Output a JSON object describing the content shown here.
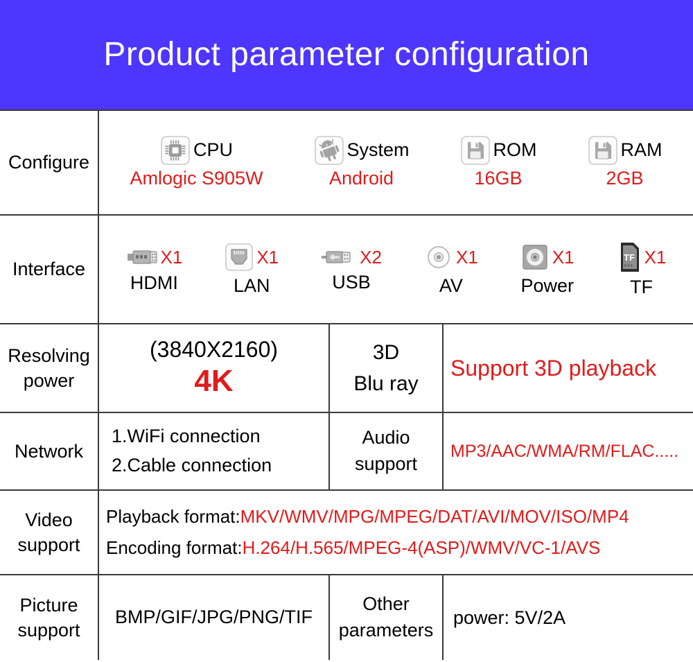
{
  "header": {
    "title": "Product parameter configuration",
    "background_color": "#4d36fe",
    "text_color": "#ffffff"
  },
  "colors": {
    "accent_red": "#e01b1b",
    "banner_blue": "#4d36fe",
    "border": "#3a3a3a"
  },
  "rows": {
    "configure": {
      "label": "Configure",
      "items": [
        {
          "icon": "cpu-chip-icon",
          "name": "CPU",
          "value": "Amlogic S905W"
        },
        {
          "icon": "android-robot-icon",
          "name": "System",
          "value": "Android"
        },
        {
          "icon": "floppy-disk-icon",
          "name": "ROM",
          "value": "16GB"
        },
        {
          "icon": "floppy-disk-icon",
          "name": "RAM",
          "value": "2GB"
        }
      ]
    },
    "interface": {
      "label": "Interface",
      "items": [
        {
          "icon": "hdmi-connector-icon",
          "count": "X1",
          "label": "HDMI"
        },
        {
          "icon": "lan-rj45-port-icon",
          "count": "X1",
          "label": "LAN"
        },
        {
          "icon": "usb-connector-icon",
          "count": "X2",
          "label": "USB"
        },
        {
          "icon": "av-jack-icon",
          "count": "X1",
          "label": "AV"
        },
        {
          "icon": "power-jack-icon",
          "count": "X1",
          "label": "Power"
        },
        {
          "icon": "tf-card-icon",
          "count": "X1",
          "label": "TF"
        }
      ]
    },
    "resolving": {
      "label_line1": "Resolving",
      "label_line2": "power",
      "resolution": "(3840X2160)",
      "resolution_short": "4K",
      "threed_line1": "3D",
      "threed_line2": "Blu ray",
      "threed_support": "Support 3D playback"
    },
    "network": {
      "label": "Network",
      "option1": "1.WiFi connection",
      "option2": "2.Cable connection",
      "audio_label_line1": "Audio",
      "audio_label_line2": "support",
      "audio_formats": "MP3/AAC/WMA/RM/FLAC....."
    },
    "video": {
      "label_line1": "Video",
      "label_line2": "support",
      "playback_label": "Playback format:",
      "playback_value": "MKV/WMV/MPG/MPEG/DAT/AVI/MOV/ISO/MP4",
      "encoding_label": "Encoding format:",
      "encoding_value": "H.264/H.565/MPEG-4(ASP)/WMV/VC-1/AVS"
    },
    "picture": {
      "label_line1": "Picture",
      "label_line2": "support",
      "formats": "BMP/GIF/JPG/PNG/TIF",
      "other_label_line1": "Other",
      "other_label_line2": "parameters",
      "other_value": "power: 5V/2A"
    }
  }
}
